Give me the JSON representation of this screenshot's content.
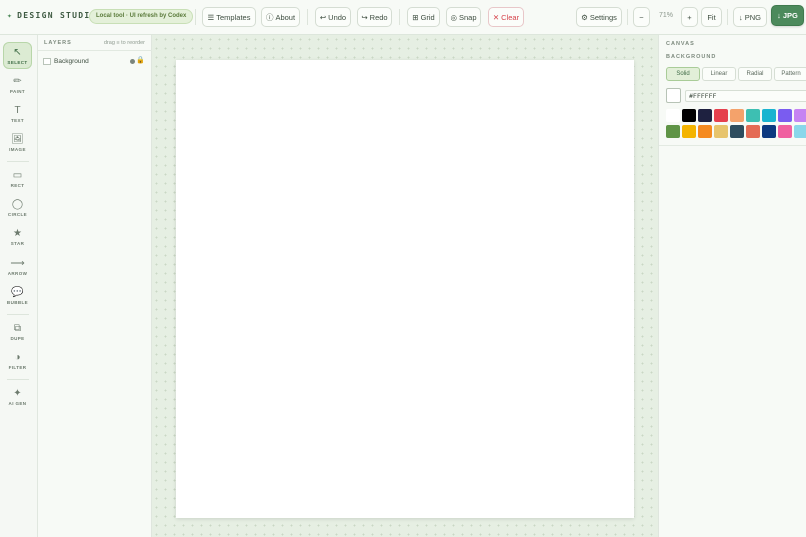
{
  "header": {
    "brand": "DESIGN STUDIO",
    "brand_icon": "✦",
    "badge": "Local tool · UI refresh by Codex",
    "buttons": {
      "templates": {
        "icon": "☰",
        "label": "Templates"
      },
      "about": {
        "icon": "ⓘ",
        "label": "About"
      },
      "undo": {
        "icon": "↩",
        "label": "Undo"
      },
      "redo": {
        "icon": "↪",
        "label": "Redo"
      },
      "grid": {
        "icon": "⊞",
        "label": "Grid"
      },
      "snap": {
        "icon": "◎",
        "label": "Snap"
      },
      "clear": {
        "icon": "✕",
        "label": "Clear"
      },
      "settings": {
        "icon": "⚙",
        "label": "Settings"
      },
      "zoom_out": "−",
      "zoom_in": "+",
      "fit": "Fit",
      "png": {
        "icon": "↓",
        "label": "PNG"
      },
      "jpg": {
        "icon": "↓",
        "label": "JPG"
      }
    },
    "zoom_level": "71%"
  },
  "tools": [
    {
      "icon": "↖",
      "label": "SELECT"
    },
    {
      "icon": "✏",
      "label": "PAINT"
    },
    {
      "icon": "T",
      "label": "TEXT"
    },
    {
      "icon": "🖼",
      "label": "IMAGE"
    },
    {
      "icon": "▭",
      "label": "RECT"
    },
    {
      "icon": "◯",
      "label": "CIRCLE"
    },
    {
      "icon": "★",
      "label": "STAR"
    },
    {
      "icon": "⟶",
      "label": "ARROW"
    },
    {
      "icon": "💬",
      "label": "BUBBLE"
    },
    {
      "icon": "⧉",
      "label": "DUPE"
    },
    {
      "icon": "◑",
      "label": "FILTER"
    },
    {
      "icon": "✦",
      "label": "AI GEN"
    }
  ],
  "layers": {
    "title": "LAYERS",
    "hint": "drag ≡ to reorder",
    "items": [
      {
        "name": "Background"
      }
    ]
  },
  "props": {
    "section": "CANVAS",
    "subsection": "BACKGROUND",
    "modes": [
      "Solid",
      "Linear",
      "Radial",
      "Pattern"
    ],
    "selected_mode": "Solid",
    "hex_value": "#FFFFFF",
    "swatches_row1": [
      "#ffffff",
      "#000000",
      "#1e2140",
      "#e5404d",
      "#f4a26b",
      "#3dbfb2",
      "#19b4d0",
      "#7a5cf0",
      "#c683f2"
    ],
    "swatches_row2": [
      "#5f9446",
      "#f4b400",
      "#f58a1f",
      "#e7c46c",
      "#2e4d5e",
      "#e46b55",
      "#0d3a80",
      "#f060a0",
      "#8ad7ea"
    ]
  }
}
